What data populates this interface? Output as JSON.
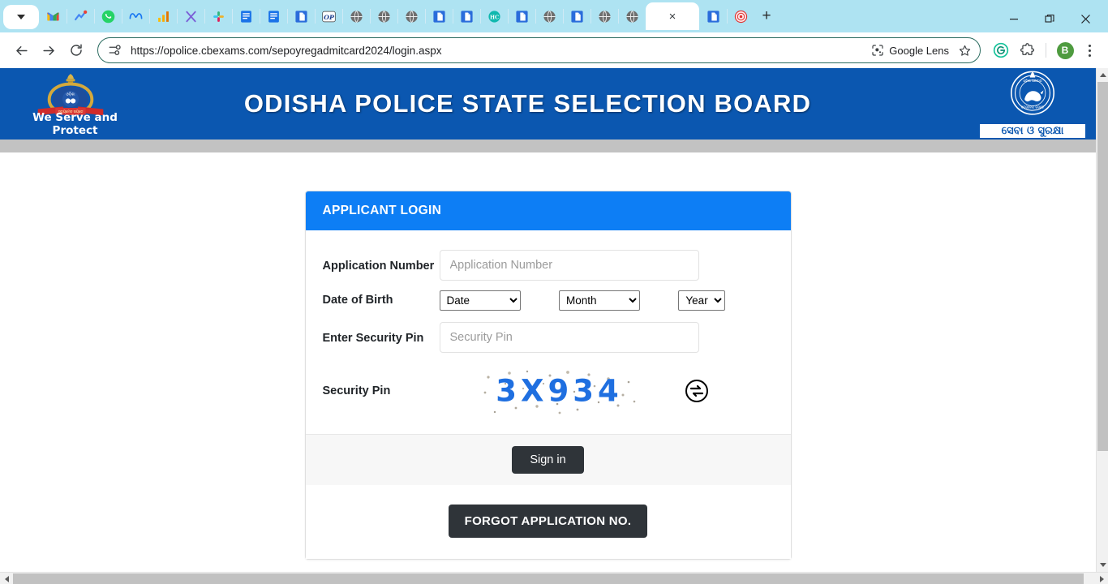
{
  "browser": {
    "tab_search_icon": "chevron-down-icon",
    "pinned_tabs": [
      {
        "name": "gmail",
        "type": "gmail"
      },
      {
        "name": "analytics",
        "type": "analytics"
      },
      {
        "name": "whatsapp",
        "type": "whatsapp"
      },
      {
        "name": "meta",
        "type": "meta"
      },
      {
        "name": "chart",
        "type": "chart"
      },
      {
        "name": "excel-x",
        "type": "x"
      },
      {
        "name": "slack",
        "type": "slack"
      },
      {
        "name": "docs",
        "type": "docs"
      },
      {
        "name": "docs",
        "type": "docs"
      },
      {
        "name": "doc-blue",
        "type": "docblue"
      },
      {
        "name": "op-site",
        "type": "op"
      },
      {
        "name": "globe",
        "type": "globe"
      },
      {
        "name": "globe",
        "type": "globe"
      },
      {
        "name": "globe",
        "type": "globe"
      },
      {
        "name": "doc-blue",
        "type": "docblue"
      },
      {
        "name": "doc-blue",
        "type": "docblue"
      },
      {
        "name": "hc-site",
        "type": "hc"
      },
      {
        "name": "doc-blue",
        "type": "docblue"
      },
      {
        "name": "globe",
        "type": "globe"
      },
      {
        "name": "doc-blue",
        "type": "docblue"
      },
      {
        "name": "globe",
        "type": "globe"
      },
      {
        "name": "globe",
        "type": "globe"
      }
    ],
    "active_tab": {
      "close_label": "×"
    },
    "trailing_tabs": [
      {
        "name": "doc-blue",
        "type": "docblue"
      },
      {
        "name": "seal-red",
        "type": "sealred"
      }
    ],
    "new_tab_label": "+",
    "window_controls": {
      "minimize": "–",
      "maximize": "❐",
      "close": "✕"
    },
    "nav": {
      "back": "←",
      "forward": "→",
      "reload": "↻"
    },
    "omnibox": {
      "site_icon": "page-info-icon",
      "url": "https://opolice.cbexams.com/sepoyregadmitcard2024/login.aspx",
      "lens_label": "Google Lens",
      "bookmark_icon": "star-icon"
    },
    "extensions": {
      "grammarly_icon": "grammarly-icon",
      "puzzle_icon": "extensions-puzzle-icon",
      "profile_initial": "B",
      "menu_icon": "kebab-menu-icon"
    }
  },
  "page": {
    "banner": {
      "title": "ODISHA POLICE STATE SELECTION BOARD",
      "left_logo_name": "odisha-police-emblem",
      "left_tagline": "We Serve and Protect",
      "right_logo_name": "odisha-govt-seal",
      "right_caption": "ସେବା ଓ ସୁରକ୍ଷା",
      "bg_color": "#0b57b0"
    },
    "card": {
      "header": "APPLICANT LOGIN",
      "header_color": "#0d7ef5",
      "fields": {
        "application_number": {
          "label": "Application Number",
          "placeholder": "Application Number",
          "value": ""
        },
        "date_of_birth": {
          "label": "Date of Birth",
          "date": {
            "selected": "Date",
            "options": [
              "Date"
            ]
          },
          "month": {
            "selected": "Month",
            "options": [
              "Month"
            ]
          },
          "year": {
            "selected": "Year",
            "options": [
              "Year"
            ]
          }
        },
        "enter_security_pin": {
          "label": "Enter Security Pin",
          "placeholder": "Security Pin",
          "value": ""
        },
        "security_pin": {
          "label": "Security Pin",
          "captcha_text": "3X934",
          "captcha_color": "#1f6fe0",
          "refresh_icon": "refresh-captcha-icon"
        }
      },
      "sign_in_label": "Sign in",
      "forgot_label": "FORGOT APPLICATION NO.",
      "button_color": "#2f3439"
    }
  }
}
